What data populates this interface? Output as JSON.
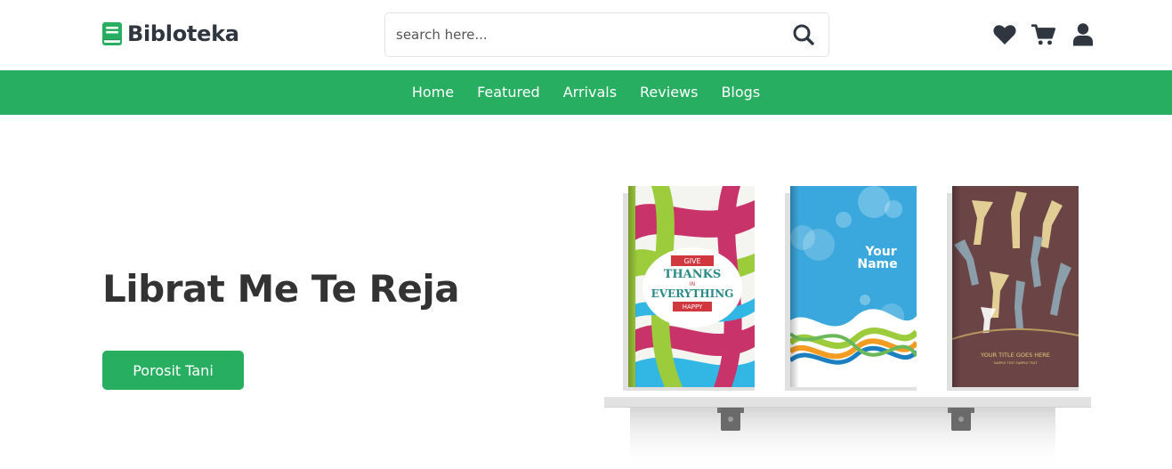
{
  "header": {
    "logo_text": "Bibloteka",
    "search_placeholder": "search here...",
    "search_value": "",
    "icons": [
      "heart-icon",
      "cart-icon",
      "user-icon"
    ]
  },
  "nav": {
    "items": [
      {
        "label": "Home"
      },
      {
        "label": "Featured"
      },
      {
        "label": "Arrivals"
      },
      {
        "label": "Reviews"
      },
      {
        "label": "Blogs"
      }
    ]
  },
  "hero": {
    "title": "Librat Me Te Reja",
    "button_label": "Porosit Tani"
  },
  "books": [
    {
      "cover_lines": [
        "GIVE",
        "THANKS",
        "IN",
        "EVERYTHING",
        "HAPPY"
      ]
    },
    {
      "cover_lines": [
        "Your",
        "Name"
      ]
    },
    {
      "cover_lines": [
        "YOUR TITLE GOES HERE",
        "SAMPLE TEXT SAMPLE TEXT"
      ]
    }
  ],
  "colors": {
    "accent": "#27ae60",
    "text_dark": "#333333",
    "logo_text": "#2f3640"
  }
}
